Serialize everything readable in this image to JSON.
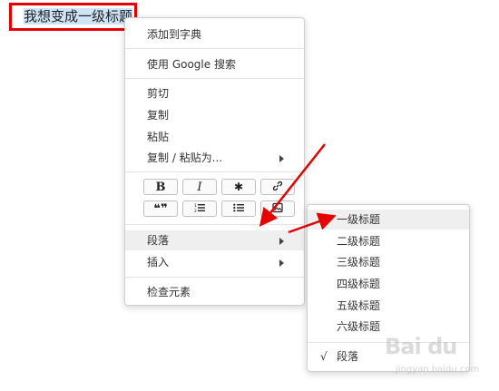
{
  "editor": {
    "heading_text": "我想变成一级标题"
  },
  "context_menu": {
    "add_to_dictionary": "添加到字典",
    "search_google": "使用 Google 搜索",
    "cut": "剪切",
    "copy": "复制",
    "paste": "粘贴",
    "copy_paste_as": "复制 / 粘贴为...",
    "format_buttons": {
      "bold": "B",
      "italic": "I",
      "asterisk": "✱",
      "link": "🔗",
      "quote": "❝❞",
      "ordered_list": "☰",
      "unordered_list": "☰",
      "image": "▣"
    },
    "paragraph": "段落",
    "insert": "插入",
    "inspect": "检查元素"
  },
  "submenu": {
    "items": [
      "一级标题",
      "二级标题",
      "三级标题",
      "四级标题",
      "五级标题",
      "六级标题"
    ],
    "paragraph_check": "√",
    "paragraph": "段落"
  },
  "watermark": {
    "logo": "Bai du",
    "sub": "jingyan.baidu.com"
  },
  "colors": {
    "highlight_border": "#e60000",
    "annotation_arrow": "#e60000",
    "selection": "#cfe4f6",
    "menu_hover": "#efefef"
  }
}
